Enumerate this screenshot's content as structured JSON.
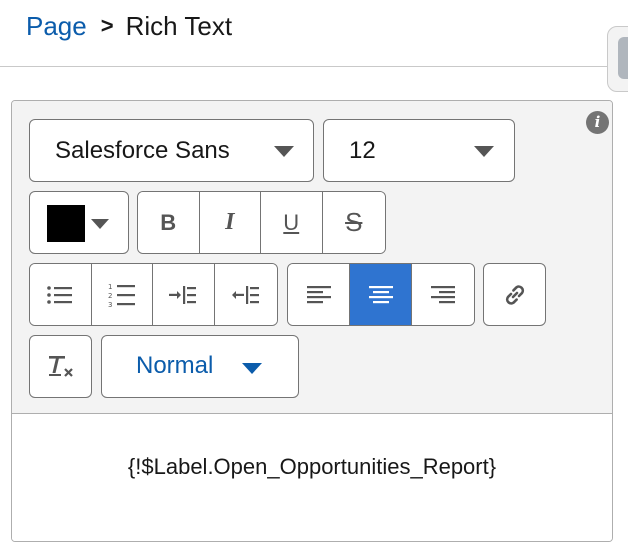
{
  "breadcrumb": {
    "parent": "Page",
    "separator": ">",
    "current": "Rich Text"
  },
  "toolbar": {
    "font_family": "Salesforce Sans",
    "font_size": "12",
    "text_color": "#000000",
    "format": {
      "bold": "B",
      "italic": "I",
      "underline": "U",
      "strikethrough": "S"
    },
    "paragraph_style": "Normal",
    "active_alignment": "center"
  },
  "content": {
    "text": "{!$Label.Open_Opportunities_Report}"
  },
  "colors": {
    "accent": "#2f74d0",
    "link": "#0b5cab",
    "border": "#747474",
    "toolbar_bg": "#f3f3f3"
  }
}
